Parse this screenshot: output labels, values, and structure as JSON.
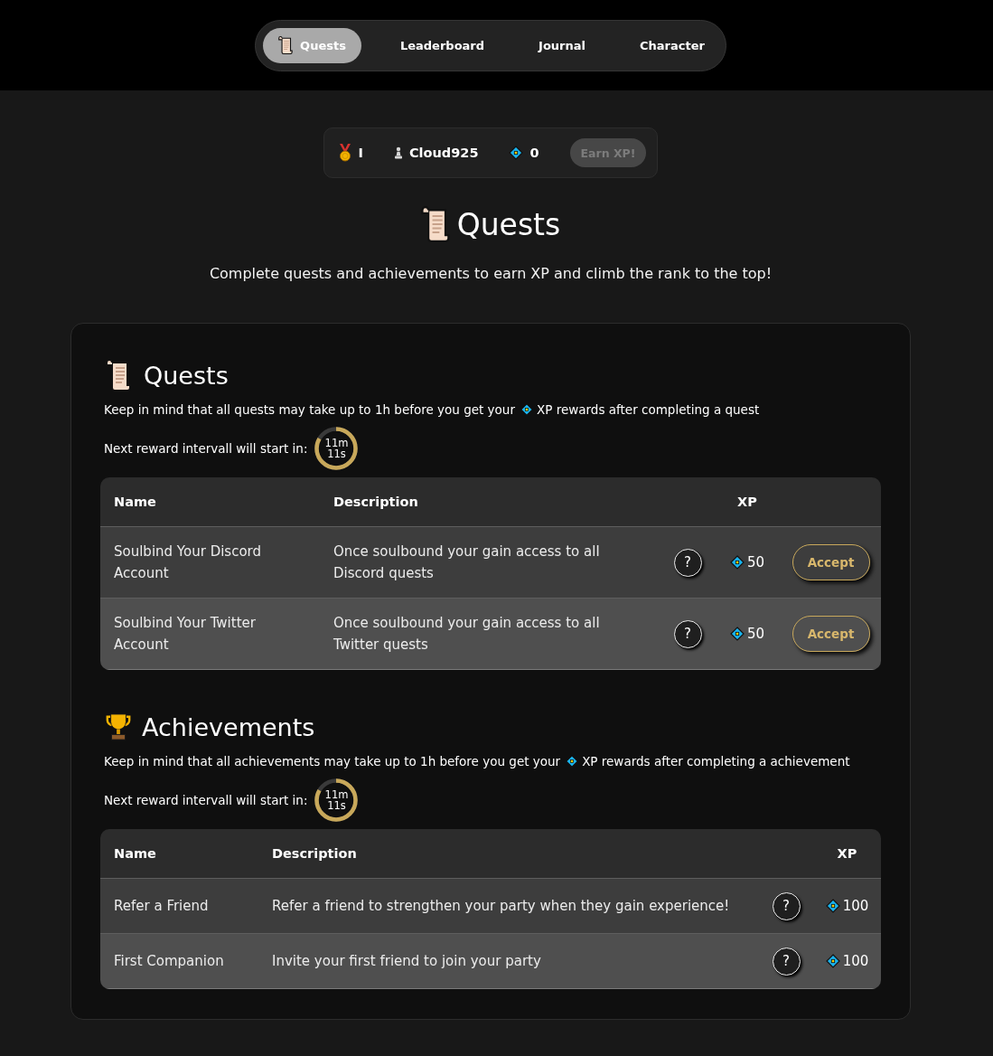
{
  "nav": {
    "tabs": [
      {
        "label": "Quests",
        "selected": true
      },
      {
        "label": "Leaderboard",
        "selected": false
      },
      {
        "label": "Journal",
        "selected": false
      },
      {
        "label": "Character",
        "selected": false
      }
    ]
  },
  "stats": {
    "rank": "I",
    "username": "Cloud925",
    "xp": "0",
    "earn_button": {
      "label": "Earn XP!",
      "disabled": true
    }
  },
  "page": {
    "title": "Quests",
    "subtitle": "Complete quests and achievements to earn XP and climb the rank to the top!"
  },
  "sections": [
    {
      "kind": "quests",
      "title": "Quests",
      "note_before": "Keep in mind that all quests may take up to 1h before you get your",
      "note_after": "XP rewards after completing a quest",
      "timer": {
        "label": "Next reward intervall will start in:",
        "minutes": "11m",
        "seconds": "11s",
        "level": 0.83
      },
      "table": {
        "columns": [
          "Name",
          "Description",
          "XP"
        ],
        "rows": [
          {
            "name": "Soulbind Your Discord Account",
            "description": "Once soulbound your gain access to all Discord quests",
            "help": "?",
            "xp": "50",
            "action": "Accept"
          },
          {
            "name": "Soulbind Your Twitter Account",
            "description": "Once soulbound your gain access to all Twitter quests",
            "help": "?",
            "xp": "50",
            "action": "Accept"
          }
        ]
      }
    },
    {
      "kind": "achievements",
      "title": "Achievements",
      "note_before": "Keep in mind that all achievements may take up to 1h before you get your",
      "note_after": "XP rewards after completing a achievement",
      "timer": {
        "label": "Next reward intervall will start in:",
        "minutes": "11m",
        "seconds": "11s",
        "level": 0.83
      },
      "table": {
        "columns": [
          "Name",
          "Description",
          "XP"
        ],
        "rows": [
          {
            "name": "Refer a Friend",
            "description": "Refer a friend to strengthen your party when they gain experience!",
            "help": "?",
            "xp": "100"
          },
          {
            "name": "First Companion",
            "description": "Invite your first friend to join your party",
            "help": "?",
            "xp": "100"
          }
        ]
      }
    }
  ]
}
